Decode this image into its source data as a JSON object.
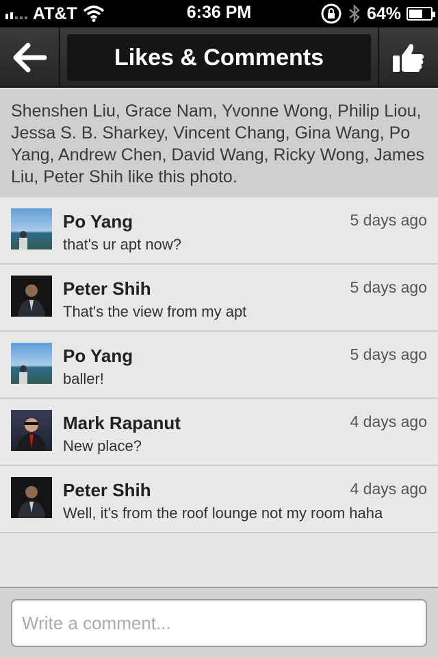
{
  "status_bar": {
    "carrier": "AT&T",
    "time": "6:36 PM",
    "battery": "64%",
    "battery_level": 0.64
  },
  "nav": {
    "title": "Likes & Comments",
    "back_icon": "back-arrow-icon",
    "like_icon": "thumbs-up-icon"
  },
  "likes": {
    "text": "Shenshen Liu, Grace Nam, Yvonne Wong, Philip Liou, Jessa S. B. Sharkey, Vincent Chang, Gina Wang, Po Yang, Andrew Chen, David Wang, Ricky Wong, James Liu, Peter Shih like this photo."
  },
  "comments": [
    {
      "name": "Po Yang",
      "time": "5 days ago",
      "text": "that's ur apt now?"
    },
    {
      "name": "Peter Shih",
      "time": "5 days ago",
      "text": "That's the view from my apt"
    },
    {
      "name": "Po Yang",
      "time": "5 days ago",
      "text": "baller!"
    },
    {
      "name": "Mark Rapanut",
      "time": "4 days ago",
      "text": "New place?"
    },
    {
      "name": "Peter Shih",
      "time": "4 days ago",
      "text": "Well, it's from the roof lounge not my room haha"
    }
  ],
  "composer": {
    "placeholder": "Write a comment..."
  }
}
